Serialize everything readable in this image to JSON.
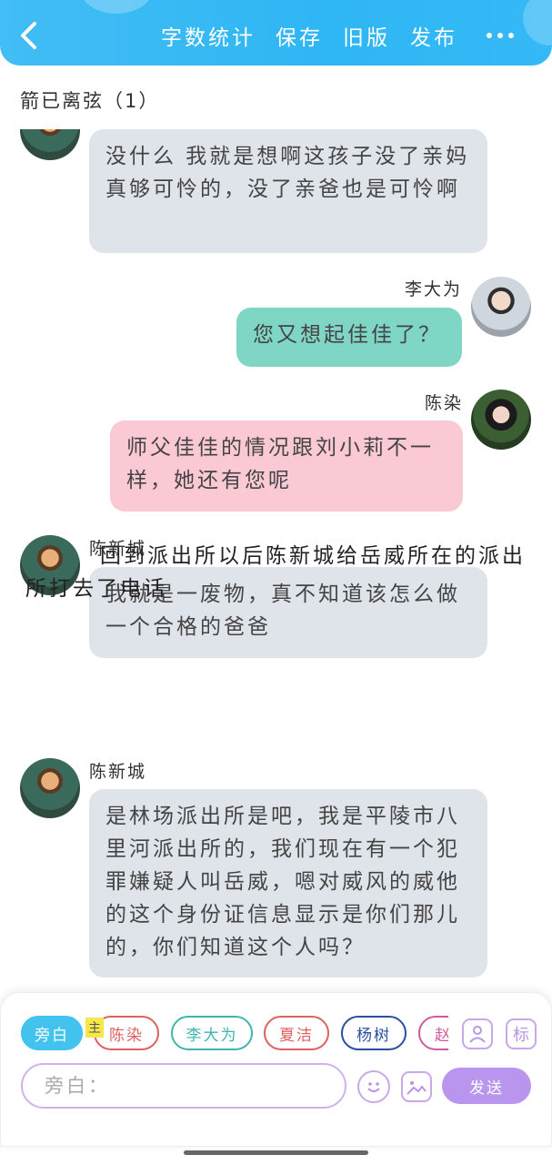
{
  "header": {
    "back_icon": "chevron-left-icon",
    "actions": [
      "字数统计",
      "保存",
      "旧版",
      "发布"
    ],
    "more_icon": "more-horizontal-icon",
    "accent_color": "#3bb8f4"
  },
  "doc_title": "箭已离弦（1）",
  "messages": [
    {
      "speaker": "",
      "side": "left",
      "style": "gray",
      "text": "没什么 我就是想啊这孩子没了亲妈真够可怜的，没了亲爸也是可怜啊"
    },
    {
      "speaker": "李大为",
      "side": "right",
      "style": "teal",
      "text": "您又想起佳佳了？"
    },
    {
      "speaker": "陈染",
      "side": "right",
      "style": "pink",
      "text": "师父佳佳的情况跟刘小莉不一样，她还有您呢"
    },
    {
      "speaker": "陈新城",
      "side": "left",
      "style": "gray",
      "text": "我就是一废物，真不知道该怎么做一个合格的爸爸"
    },
    {
      "speaker": "陈新城",
      "side": "left",
      "style": "gray",
      "text": "是林场派出所是吧，我是平陵市八里河派出所的，我们现在有一个犯罪嫌疑人叫岳威，嗯对威风的威他的这个身份证信息显示是你们那儿的，你们知道这个人吗？"
    }
  ],
  "narration": "回到派出所以后陈新城给岳威所在的派出所打去了电话",
  "composer": {
    "chips": [
      "旁白",
      "陈染",
      "李大为",
      "夏洁",
      "杨树",
      "赵"
    ],
    "main_badge": "主",
    "contact_icon": "contact-card-icon",
    "tag_label": "标",
    "input_placeholder": "旁白：",
    "emoji_icon": "smiley-icon",
    "image_icon": "image-icon",
    "send_label": "发送",
    "chip_colors": [
      "#41c3ee",
      "#e06060",
      "#3fb5b0",
      "#e06060",
      "#2a4f9e",
      "#d05aa0"
    ]
  }
}
